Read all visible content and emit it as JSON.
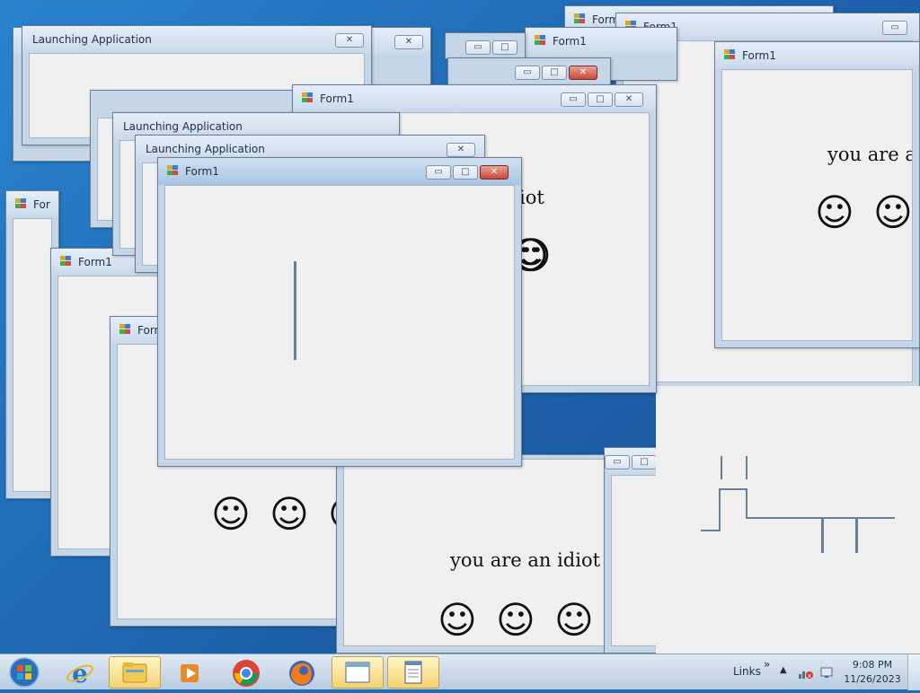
{
  "windows": {
    "form1_title": "Form1",
    "launching_title": "Launching Application",
    "partial_title_for": "For",
    "partial_title_forn": "Forr",
    "message": "you are an idiot",
    "message_partial_right": "you are an",
    "message_fragment_iot": "iot",
    "message_fragment_yo": "yo",
    "smiley": "☺",
    "buttons": {
      "minimize": "▭",
      "maximize": "□",
      "close": "✕"
    }
  },
  "taskbar": {
    "start_label": "Start",
    "items": [
      {
        "name": "internet-explorer",
        "icon": "ie-icon"
      },
      {
        "name": "windows-explorer",
        "icon": "folder-icon"
      },
      {
        "name": "windows-media-player",
        "icon": "media-player-icon"
      },
      {
        "name": "google-chrome",
        "icon": "chrome-icon"
      },
      {
        "name": "mozilla-firefox",
        "icon": "firefox-icon"
      },
      {
        "name": "form1-app",
        "icon": "window-icon"
      },
      {
        "name": "notepad-app",
        "icon": "notepad-icon"
      }
    ],
    "links_label": "Links",
    "tray_arrow": "»",
    "time": "9:08 PM",
    "date": "11/26/2023"
  },
  "colors": {
    "accent": "#2a83cf",
    "close_red": "#c8493a",
    "taskbar_active": "#f4d372"
  }
}
